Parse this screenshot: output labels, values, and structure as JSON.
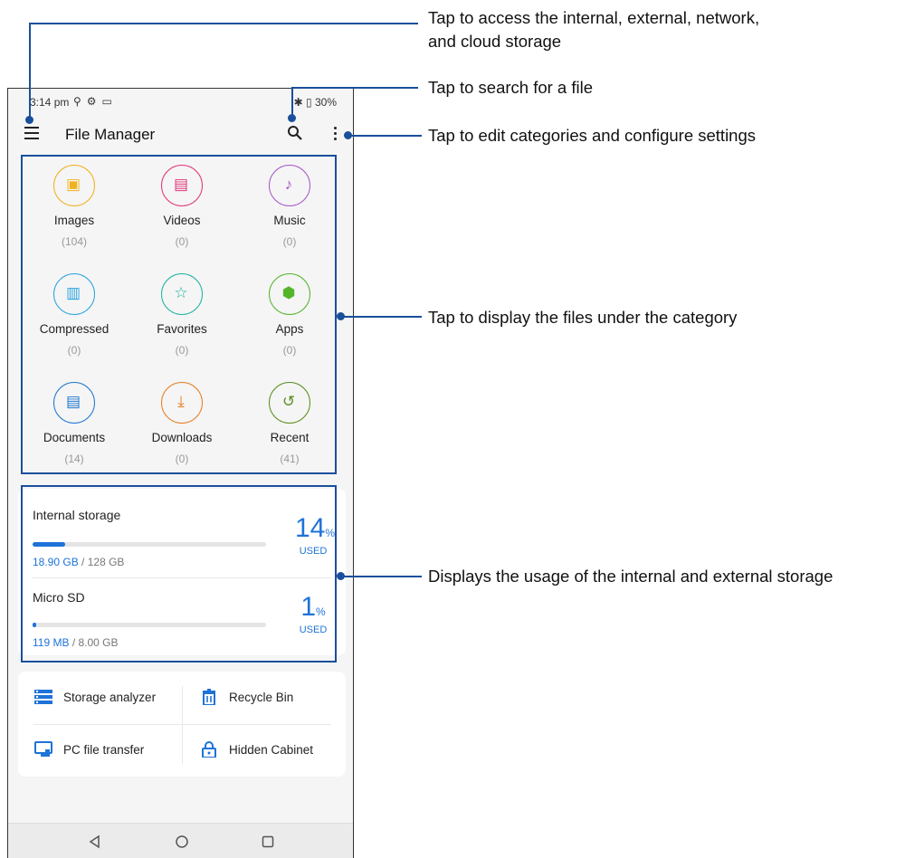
{
  "status_bar": {
    "time": "3:14 pm",
    "battery": "30%"
  },
  "app_bar": {
    "title": "File Manager"
  },
  "categories": [
    {
      "label": "Images",
      "count": "(104)",
      "icon": "image-icon",
      "color": "#f0b21e"
    },
    {
      "label": "Videos",
      "count": "(0)",
      "icon": "video-icon",
      "color": "#e0357a"
    },
    {
      "label": "Music",
      "count": "(0)",
      "icon": "music-icon",
      "color": "#a659c9"
    },
    {
      "label": "Compressed",
      "count": "(0)",
      "icon": "compressed-icon",
      "color": "#2aa3e0"
    },
    {
      "label": "Favorites",
      "count": "(0)",
      "icon": "star-icon",
      "color": "#1eb3a0"
    },
    {
      "label": "Apps",
      "count": "(0)",
      "icon": "android-icon",
      "color": "#55b52a"
    },
    {
      "label": "Documents",
      "count": "(14)",
      "icon": "document-icon",
      "color": "#1f78d0"
    },
    {
      "label": "Downloads",
      "count": "(0)",
      "icon": "download-icon",
      "color": "#e67e22"
    },
    {
      "label": "Recent",
      "count": "(41)",
      "icon": "history-icon",
      "color": "#5a8f1e"
    }
  ],
  "storage": {
    "internal": {
      "name": "Internal storage",
      "used": "18.90 GB",
      "total": "/ 128 GB",
      "percent": "14",
      "percent_sign": "%",
      "used_label": "USED",
      "fraction": 0.14
    },
    "sd": {
      "name": "Micro SD",
      "used": "119 MB",
      "total": "/ 8.00 GB",
      "percent": "1",
      "percent_sign": "%",
      "used_label": "USED",
      "fraction": 0.015
    }
  },
  "tools": {
    "analyzer": "Storage analyzer",
    "recycle": "Recycle Bin",
    "pc_transfer": "PC file transfer",
    "hidden": "Hidden Cabinet"
  },
  "annotations": {
    "menu": "Tap to access the internal, external, network,",
    "menu_line2": "and cloud storage",
    "search": "Tap to search for a file",
    "more": "Tap to edit categories and configure settings",
    "categories": "Tap to display the files under the category",
    "storage": "Displays the usage of the internal and external storage"
  },
  "accent_color": "#1e73d8",
  "annotation_color": "#1a4f9c"
}
